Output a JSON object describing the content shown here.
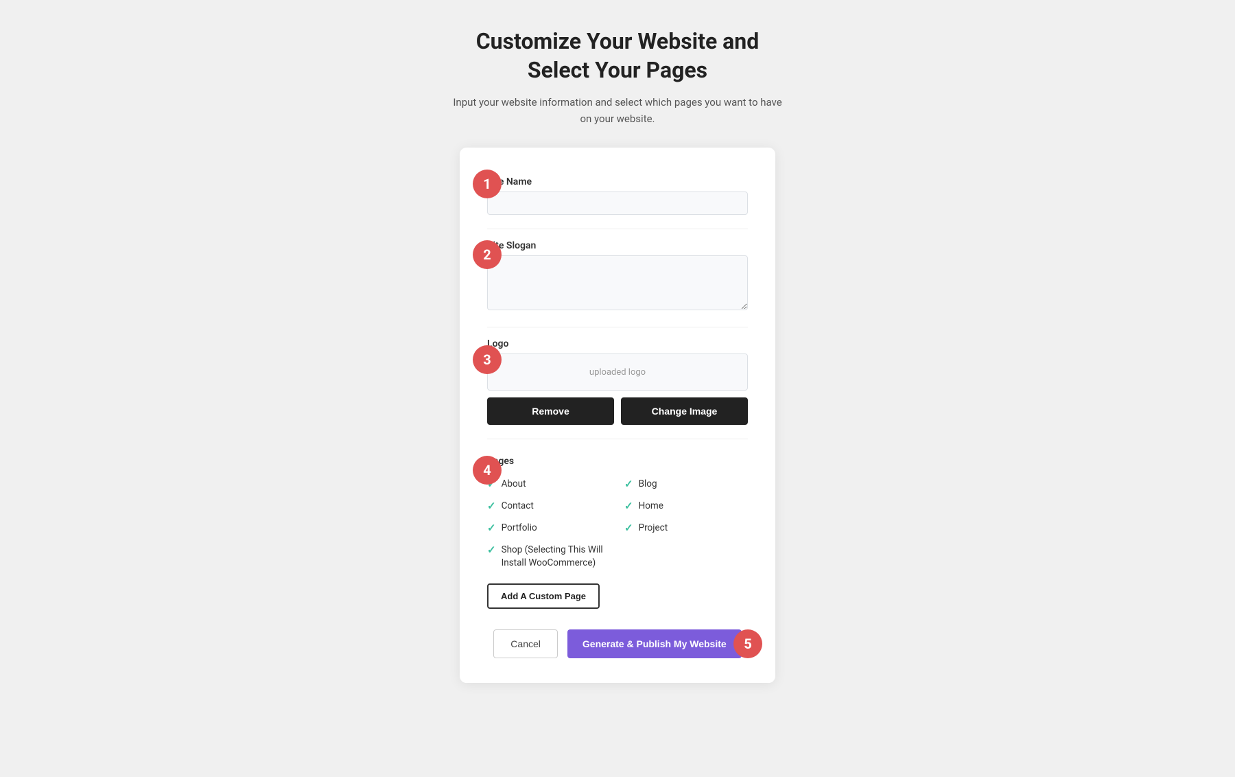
{
  "header": {
    "title_line1": "Customize Your Website and",
    "title_line2": "Select Your Pages",
    "subtitle": "Input your website information and select which pages you want to have on your website."
  },
  "steps": {
    "step1": "1",
    "step2": "2",
    "step3": "3",
    "step4": "4",
    "step5": "5"
  },
  "fields": {
    "site_name_label": "Site Name",
    "site_name_placeholder": "",
    "site_slogan_label": "Site Slogan",
    "site_slogan_placeholder": "",
    "logo_label": "Logo",
    "logo_placeholder": "uploaded logo",
    "remove_label": "Remove",
    "change_image_label": "Change Image"
  },
  "pages": {
    "label": "Pages",
    "items": [
      {
        "name": "About",
        "checked": true
      },
      {
        "name": "Blog",
        "checked": true
      },
      {
        "name": "Contact",
        "checked": true
      },
      {
        "name": "Home",
        "checked": true
      },
      {
        "name": "Portfolio",
        "checked": true
      },
      {
        "name": "Project",
        "checked": true
      }
    ],
    "shop_label": "Shop (Selecting This Will Install WooCommerce)",
    "shop_checked": true,
    "add_custom_label": "Add A Custom Page"
  },
  "footer": {
    "cancel_label": "Cancel",
    "publish_label": "Generate & Publish My Website"
  },
  "icons": {
    "checkmark": "✓",
    "image_icon": "🖼"
  }
}
